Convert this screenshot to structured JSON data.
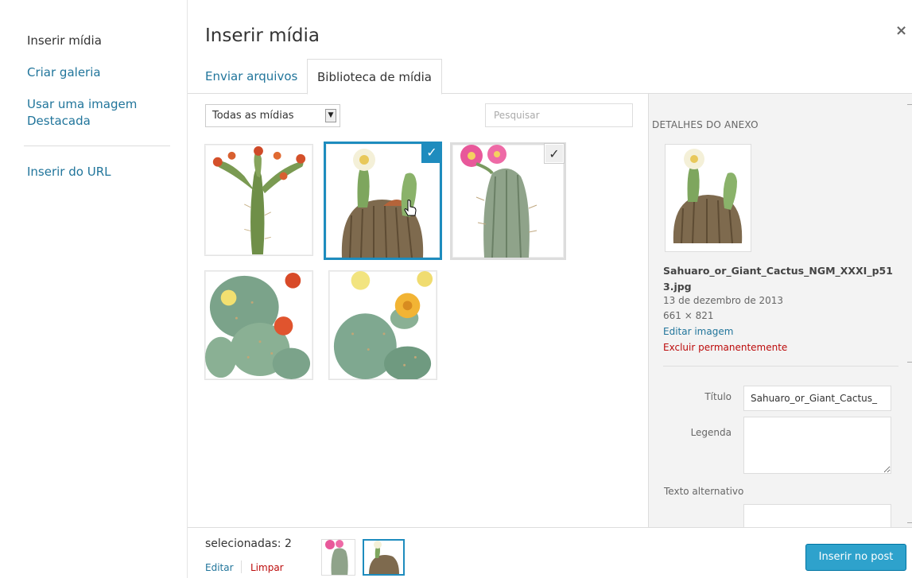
{
  "menu": {
    "items": [
      {
        "label": "Inserir mídia",
        "active": true
      },
      {
        "label": "Criar galeria"
      },
      {
        "label": "Usar uma imagem Destacada"
      },
      {
        "label": "Inserir do URL"
      }
    ]
  },
  "frame": {
    "title": "Inserir mídia",
    "close_icon": "×",
    "tabs": [
      {
        "label": "Enviar arquivos"
      },
      {
        "label": "Biblioteca de mídia",
        "active": true
      }
    ]
  },
  "toolbar": {
    "filter_value": "Todas as mídias",
    "filter_arrow": "▼",
    "search_placeholder": "Pesquisar"
  },
  "grid": {
    "check_glyph": "✓",
    "items": [
      {
        "icon": "prickly-pear-orange-flowers-image"
      },
      {
        "icon": "barrel-cactus-image",
        "selected": true
      },
      {
        "icon": "pink-flower-cactus-image",
        "selected": true
      },
      {
        "icon": "opuntia-orange-flowers-image"
      },
      {
        "icon": "opuntia-yellow-flowers-image"
      }
    ]
  },
  "details": {
    "heading": "DETALHES DO ANEXO",
    "filename": "Sahuaro_or_Giant_Cactus_NGM_XXXI_p513.jpg",
    "date": "13 de dezembro de 2013",
    "dimensions": "661 × 821",
    "edit_link": "Editar imagem",
    "delete_link": "Excluir permanentemente",
    "title_label": "Título",
    "title_value": "Sahuaro_or_Giant_Cactus_",
    "caption_label": "Legenda",
    "caption_value": "",
    "alt_label": "Texto alternativo",
    "alt_value": ""
  },
  "bottom": {
    "selected_count": "selecionadas: 2",
    "edit": "Editar",
    "clear": "Limpar",
    "insert_button": "Inserir no post"
  },
  "colors": {
    "accent": "#1e8cbe",
    "link": "#21759b",
    "danger": "#bc0b0b",
    "button": "#2ea2cc"
  }
}
